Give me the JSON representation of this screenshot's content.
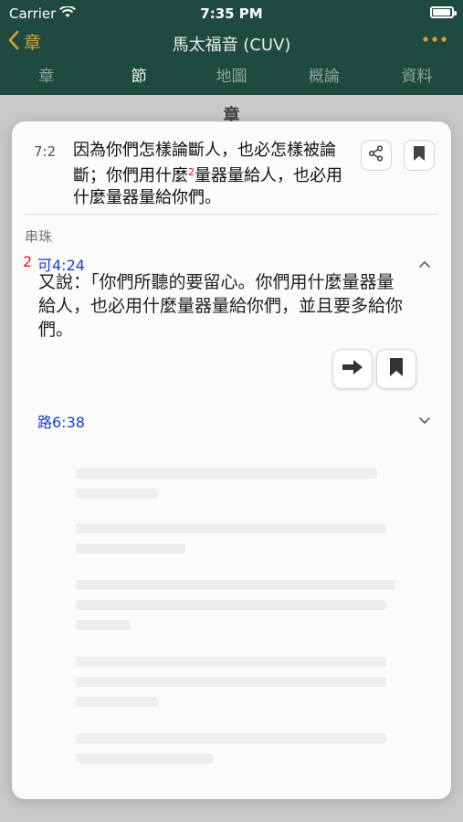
{
  "status": {
    "carrier": "Carrier",
    "time": "7:35 PM",
    "battery_level": 0.95
  },
  "nav": {
    "back_label": "章",
    "title": "馬太福音 (CUV)",
    "more_icon": "ellipsis-icon",
    "tabs": [
      {
        "label": "章",
        "active": false
      },
      {
        "label": "節",
        "active": true
      },
      {
        "label": "地圖",
        "active": false
      },
      {
        "label": "概論",
        "active": false
      },
      {
        "label": "資料",
        "active": false
      }
    ]
  },
  "background": {
    "chapter_heading": "章"
  },
  "sheet": {
    "verse_number": "7:2",
    "verse_text_before": "因為你們怎樣論斷人，也必怎樣被論斷；你們用什麼",
    "verse_footnote": "2",
    "verse_text_after": "量器量給人，也必用什麼量器量給你們。",
    "cross_ref_section": "串珠",
    "refs": [
      {
        "count": "2",
        "label": "可4:24",
        "expanded": true,
        "text": "又說：「你們所聽的要留心。你們用什麼量器量給人，也必用什麼量器量給你們，並且要多給你們。"
      },
      {
        "count": "",
        "label": "路6:38",
        "expanded": false,
        "text": ""
      }
    ]
  },
  "colors": {
    "nav_bg": "#1f4a3f",
    "accent": "#d6a13a",
    "ref_link": "#1a3fd6",
    "count_red": "#e02020"
  }
}
